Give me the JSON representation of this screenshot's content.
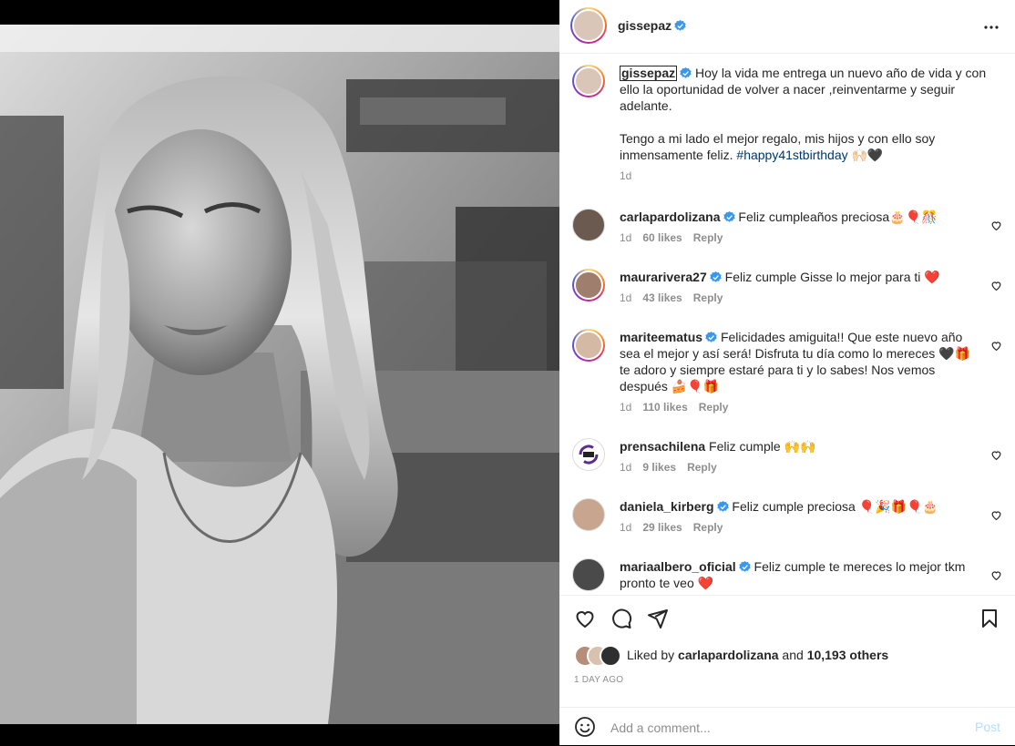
{
  "post": {
    "username": "gissepaz",
    "more_icon": "more-horizontal-icon",
    "caption": {
      "username": "gissepaz",
      "line1": "Hoy la vida me entrega un nuevo año de vida y con ello la oportunidad de volver a nacer ,reinventarme y seguir adelante.",
      "line2": "Tengo a mi lado el mejor regalo, mis hijos y con ello soy inmensamente feliz. ",
      "hashtag": "#happy41stbirthday",
      "emoji": "🙌🏻🖤",
      "time": "1d"
    },
    "comments": [
      {
        "username": "carlapardolizana",
        "verified": true,
        "text": "Feliz cumpleaños preciosa🎂🎈🎊",
        "time": "1d",
        "likes": "60 likes",
        "reply": "Reply"
      },
      {
        "username": "maurarivera27",
        "verified": true,
        "text": "Feliz cumple Gisse lo mejor para ti ❤️",
        "time": "1d",
        "likes": "43 likes",
        "reply": "Reply"
      },
      {
        "username": "mariteematus",
        "verified": true,
        "text": "Felicidades amiguita!! Que este nuevo año sea el mejor y así será! Disfruta tu día como lo mereces 🖤🎁 te adoro y siempre estaré para ti y lo sabes! Nos vemos después 🍰🎈🎁",
        "time": "1d",
        "likes": "110 likes",
        "reply": "Reply"
      },
      {
        "username": "prensachilena",
        "verified": false,
        "text": "Feliz cumple 🙌🙌",
        "time": "1d",
        "likes": "9 likes",
        "reply": "Reply"
      },
      {
        "username": "daniela_kirberg",
        "verified": true,
        "text": "Feliz cumple preciosa 🎈🎉🎁🎈🎂",
        "time": "1d",
        "likes": "29 likes",
        "reply": "Reply"
      },
      {
        "username": "mariaalbero_oficial",
        "verified": true,
        "text": "Feliz cumple te mereces lo mejor tkm pronto te veo ❤️",
        "time": "",
        "likes": "",
        "reply": ""
      }
    ],
    "likes": {
      "prefix": "Liked by ",
      "user": "carlapardolizana",
      "middle": " and ",
      "others": "10,193 others"
    },
    "time_ago": "1 DAY AGO",
    "comment_input": {
      "placeholder": "Add a comment...",
      "post_label": "Post"
    },
    "colors": {
      "verified": "#3897f0",
      "heart": "#ed4956",
      "hashtag": "#00376b",
      "muted": "#8e8e8e",
      "post_disabled": "#b2dffc"
    },
    "icons": [
      "like-icon",
      "comment-icon",
      "share-icon",
      "save-icon",
      "emoji-icon"
    ]
  }
}
